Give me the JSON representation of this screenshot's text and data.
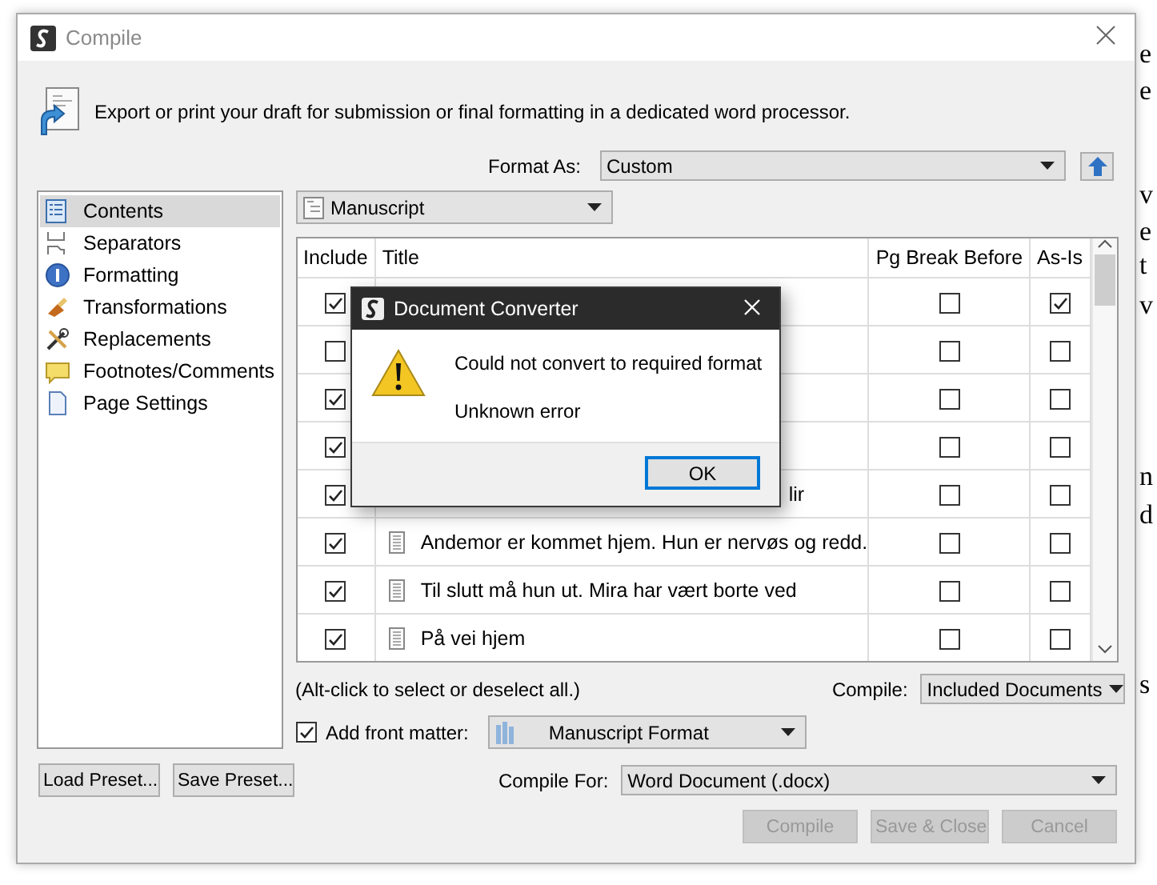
{
  "window": {
    "title": "Compile"
  },
  "description": "Export or print your draft for submission or final formatting in a dedicated word processor.",
  "format_as": {
    "label": "Format As:",
    "value": "Custom"
  },
  "sidebar": {
    "items": [
      {
        "label": "Contents",
        "selected": true
      },
      {
        "label": "Separators",
        "selected": false
      },
      {
        "label": "Formatting",
        "selected": false
      },
      {
        "label": "Transformations",
        "selected": false
      },
      {
        "label": "Replacements",
        "selected": false
      },
      {
        "label": "Footnotes/Comments",
        "selected": false
      },
      {
        "label": "Page Settings",
        "selected": false
      }
    ]
  },
  "preset_dropdown": {
    "value": "Manuscript"
  },
  "table": {
    "columns": [
      "Include",
      "Title",
      "Pg Break Before",
      "As-Is"
    ],
    "rows": [
      {
        "include": true,
        "covered": true,
        "pg_break_before": false,
        "as_is": true
      },
      {
        "include": false,
        "covered": true,
        "pg_break_before": false,
        "as_is": false
      },
      {
        "include": true,
        "covered": true,
        "pg_break_before": false,
        "as_is": false
      },
      {
        "include": true,
        "covered": true,
        "pg_break_before": false,
        "as_is": false
      },
      {
        "include": true,
        "covered": true,
        "title": "lir",
        "pg_break_before": false,
        "as_is": false
      },
      {
        "include": true,
        "covered": false,
        "title": "Andemor er kommet hjem. Hun er nervøs og redd.",
        "pg_break_before": false,
        "as_is": false
      },
      {
        "include": true,
        "covered": false,
        "title": "Til slutt må hun ut. Mira har vært borte ved",
        "pg_break_before": false,
        "as_is": false
      },
      {
        "include": true,
        "covered": false,
        "title": "På vei hjem",
        "pg_break_before": false,
        "as_is": false
      }
    ]
  },
  "hint": "(Alt-click to select or deselect all.)",
  "compile_scope": {
    "label": "Compile:",
    "value": "Included Documents"
  },
  "front_matter": {
    "label": "Add front matter:",
    "checked": true,
    "value": "Manuscript Format"
  },
  "preset_buttons": [
    "Load Preset...",
    "Save Preset..."
  ],
  "compile_for": {
    "label": "Compile For:",
    "value": "Word Document (.docx)"
  },
  "buttons": [
    {
      "label": "Compile",
      "disabled": true
    },
    {
      "label": "Save & Close",
      "disabled": true
    },
    {
      "label": "Cancel",
      "disabled": true
    }
  ],
  "dialog": {
    "title": "Document Converter",
    "message": "Could not convert to required format",
    "detail": "Unknown error",
    "button": "OK"
  },
  "background_text": [
    "e",
    "e",
    "v",
    "e",
    "t",
    "v",
    "n",
    "d",
    "s"
  ]
}
